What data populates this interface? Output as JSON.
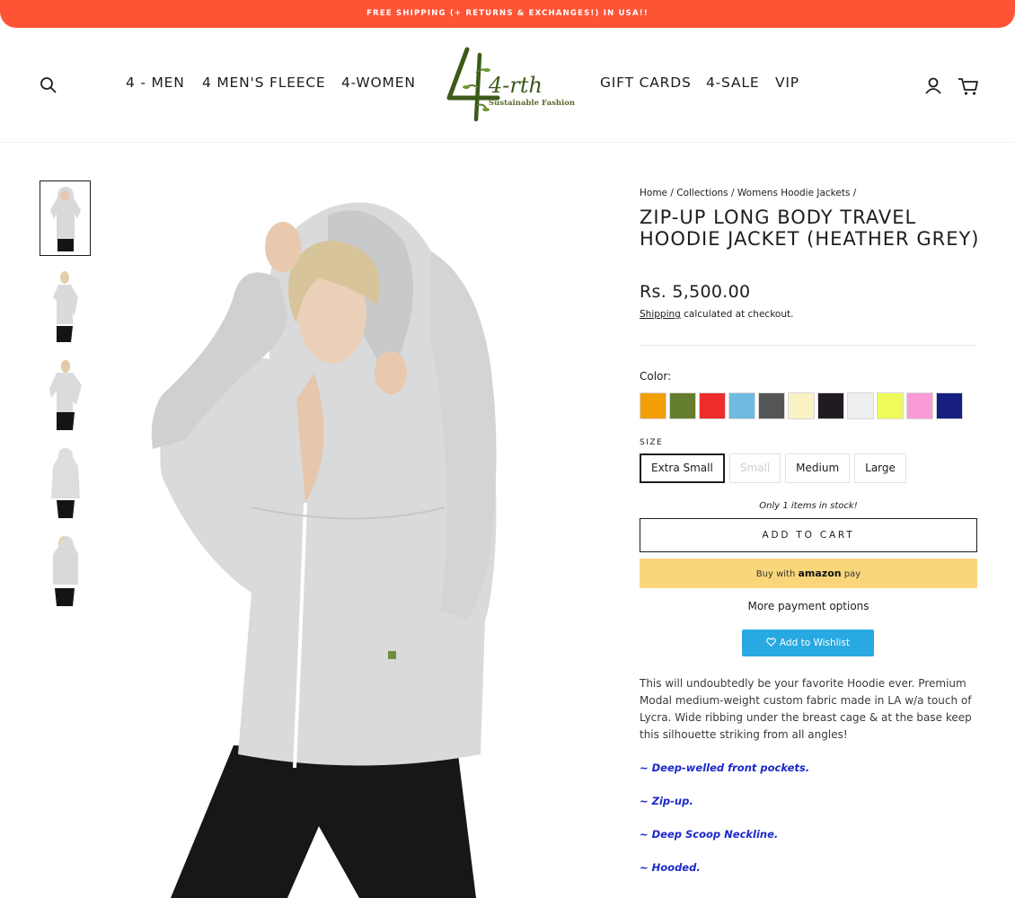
{
  "announcement": "FREE SHIPPING (+ RETURNS & EXCHANGES!) IN USA!!",
  "nav": {
    "left": [
      "4 - MEN",
      "4 MEN'S FLEECE",
      "4-WOMEN"
    ],
    "right": [
      "GIFT CARDS",
      "4-SALE",
      "VIP"
    ]
  },
  "logo": {
    "text": "4-rth",
    "tagline": "Sustainable Fashion"
  },
  "icons": {
    "search": "search-icon",
    "account": "account-icon",
    "cart": "cart-icon",
    "heart": "heart-icon"
  },
  "breadcrumb": {
    "home": "Home",
    "sep": "/",
    "collections": "Collections",
    "collection": "Womens Hoodie Jackets"
  },
  "product": {
    "title": "ZIP-UP LONG BODY TRAVEL HOODIE JACKET (HEATHER GREY)",
    "price": "Rs. 5,500.00",
    "shipping_link": "Shipping",
    "shipping_text": "calculated at checkout."
  },
  "color_label": "Color:",
  "colors": [
    "#f29f05",
    "#647d2f",
    "#ee2c2c",
    "#6fbbe0",
    "#545557",
    "#fbf2c4",
    "#221a22",
    "#efefef",
    "#eefb5b",
    "#f89bd4",
    "#161f80"
  ],
  "size_label": "SIZE",
  "sizes": [
    "Extra Small",
    "Small",
    "Medium",
    "Large"
  ],
  "stock": "Only 1 items in stock!",
  "add_to_cart": "ADD TO CART",
  "amazon": {
    "prefix": "Buy with",
    "brand": "amazon",
    "suffix": "pay"
  },
  "more_payment": "More payment options",
  "wishlist": "Add to Wishlist",
  "description": "This will undoubtedly be your favorite Hoodie ever. Premium Modal medium-weight custom fabric made in LA w/a touch of Lycra. Wide ribbing under the breast cage & at the base keep this silhouette striking from all angles!",
  "features": [
    "~ Deep-welled front pockets.",
    "~ Zip-up.",
    "~ Deep Scoop Neckline.",
    "~ Hooded."
  ]
}
